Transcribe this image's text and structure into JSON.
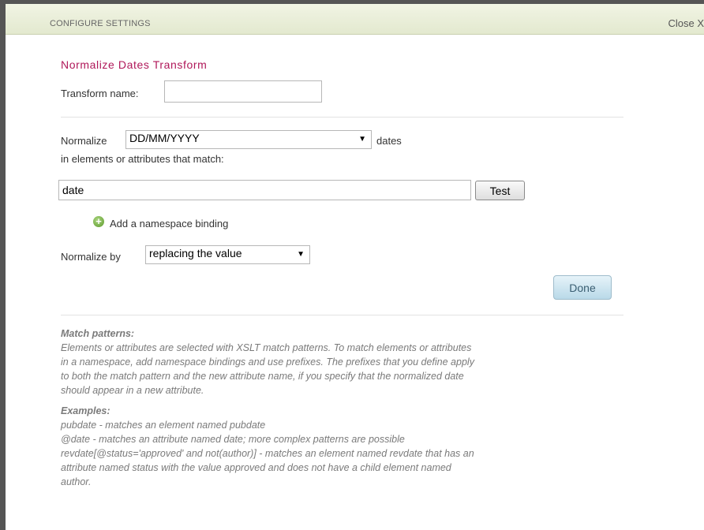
{
  "header": {
    "title": "CONFIGURE SETTINGS",
    "close_label": "Close X"
  },
  "form": {
    "title": "Normalize Dates Transform",
    "transform_name_label": "Transform name:",
    "transform_name_value": "",
    "normalize_label": "Normalize",
    "date_format_value": "DD/MM/YYYY",
    "dates_label": "dates",
    "match_label": "in elements or attributes that match:",
    "match_value": "date",
    "test_label": "Test",
    "namespace_label": "Add a namespace binding",
    "normalize_by_label": "Normalize by",
    "normalize_by_value": "replacing the value",
    "done_label": "Done"
  },
  "help": {
    "match_heading": "Match patterns:",
    "match_lines": [
      "Elements or attributes are selected with XSLT match patterns. To match elements or attributes",
      "in a namespace, add namespace bindings and use prefixes. The prefixes that you define apply",
      "to both the match pattern and the new attribute name, if you specify that the normalized date",
      "should appear in a new attribute."
    ],
    "examples_heading": "Examples:",
    "example_lines": [
      "pubdate - matches an element named pubdate",
      "@date - matches an attribute named date; more complex patterns are possible",
      "revdate[@status='approved' and not(author)] - matches an element named revdate that has an",
      "attribute named status with the value approved and does not have a child element named",
      "author."
    ]
  }
}
